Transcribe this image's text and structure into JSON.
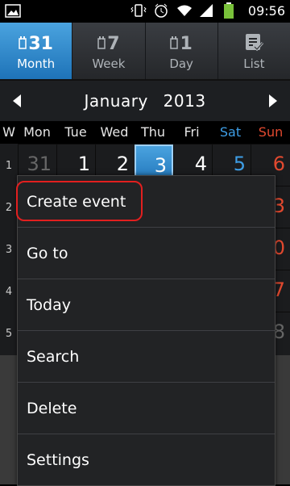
{
  "status_bar": {
    "time": "09:56",
    "icons": [
      "gallery-icon",
      "vibrate-icon",
      "alarm-icon",
      "wifi-icon",
      "signal-icon",
      "battery-icon"
    ]
  },
  "tabs": [
    {
      "label": "Month",
      "number": "31",
      "active": true
    },
    {
      "label": "Week",
      "number": "7",
      "active": false
    },
    {
      "label": "Day",
      "number": "1",
      "active": false
    },
    {
      "label": "List",
      "number": "",
      "active": false
    }
  ],
  "month_nav": {
    "month": "January",
    "year": "2013"
  },
  "weekdays": {
    "week": "W",
    "days": [
      "Mon",
      "Tue",
      "Wed",
      "Thu",
      "Fri",
      "Sat",
      "Sun"
    ]
  },
  "calendar": {
    "week_numbers": [
      "1",
      "2",
      "3",
      "4",
      "5"
    ],
    "first_row": [
      "31",
      "1",
      "2",
      "3",
      "4",
      "5",
      "6"
    ],
    "right_edge_digits": [
      "3",
      "0",
      "7",
      "8"
    ],
    "selected_day": "3"
  },
  "menu": {
    "items": [
      "Create event",
      "Go to",
      "Today",
      "Search",
      "Delete",
      "Settings"
    ]
  },
  "colors": {
    "accent": "#2f86cc",
    "saturday": "#3e9ee6",
    "sunday": "#e2492f",
    "highlight_box": "#e21f1f"
  }
}
